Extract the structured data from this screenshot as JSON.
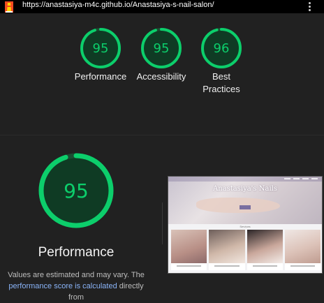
{
  "browser": {
    "url": "https://anastasiya-m4c.github.io/Anastasiya-s-nail-salon/",
    "logo_icon": "lighthouse-icon",
    "menu_icon": "kebab-menu-icon"
  },
  "colors": {
    "pass": "#0cce6b",
    "pass_fill": "#0f3b24",
    "ring_track": "#1b4d32",
    "background": "#212121",
    "link": "#8ab4f8"
  },
  "summary_scores": [
    {
      "label": "Performance",
      "score": 95
    },
    {
      "label": "Accessibility",
      "score": 95
    },
    {
      "label": "Best Practices",
      "score": 96
    }
  ],
  "main_category": {
    "title": "Performance",
    "score": 95,
    "desc_prefix": "Values are estimated and may vary. The",
    "desc_link": "performance score is calculated",
    "desc_suffix": "directly from"
  },
  "screenshot_preview": {
    "site_title": "Anastasiya's Nails",
    "section_label": "Services"
  }
}
